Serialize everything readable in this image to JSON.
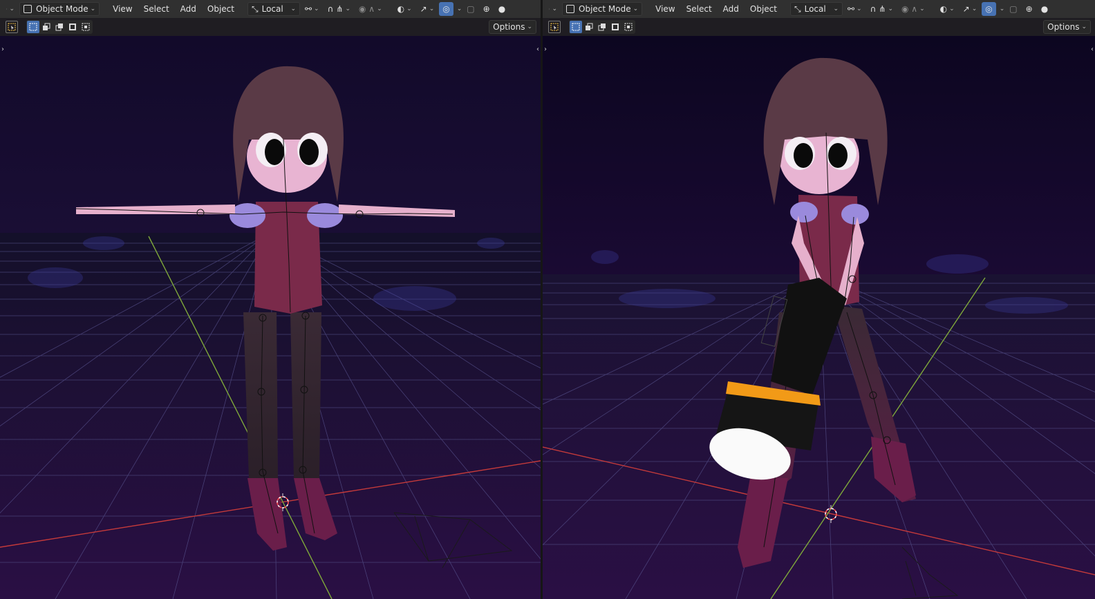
{
  "viewports": [
    {
      "id": "left",
      "mode_label": "Object Mode",
      "menus": [
        "View",
        "Select",
        "Add",
        "Object"
      ],
      "transform_orientation": "Local",
      "options_label": "Options"
    },
    {
      "id": "right",
      "mode_label": "Object Mode",
      "menus": [
        "View",
        "Select",
        "Add",
        "Object"
      ],
      "transform_orientation": "Local",
      "options_label": "Options"
    }
  ],
  "icons": {
    "editor_type": "editor-type-icon",
    "mode": "object-mode-icon",
    "orientation": "transform-orientation-icon",
    "pivot": "pivot-icon",
    "snap": "snap-icon",
    "proportional": "proportional-edit-icon",
    "visibility": "object-visibility-icon",
    "gizmo": "gizmo-icon",
    "overlay": "overlay-icon",
    "xray": "xray-icon",
    "wireframe": "wireframe-shading-icon",
    "solid": "solid-shading-icon",
    "select_tool": "select-box-tool-icon"
  },
  "colors": {
    "header_bg": "#303030",
    "accent_blue": "#4772b3",
    "world_bg": "#0e0818",
    "grid": "#6a5aa0",
    "x_axis": "#c53a3a",
    "y_axis": "#7fa83a",
    "flashlight_band": "#f29a17"
  }
}
